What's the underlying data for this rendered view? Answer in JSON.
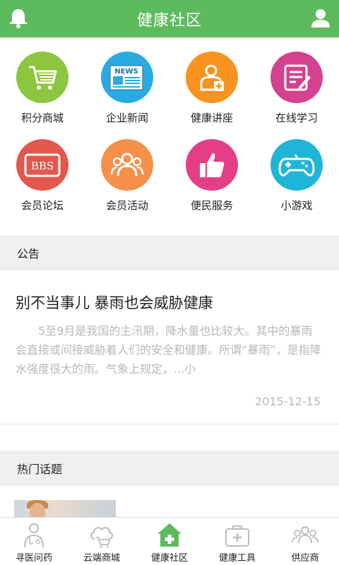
{
  "header": {
    "title": "健康社区",
    "left_icon": "bell-icon",
    "right_icon": "user-icon",
    "color": "#5dbb5d"
  },
  "grid": {
    "items": [
      {
        "label": "积分商城",
        "icon": "shopping-cart-icon",
        "color": "#8cc63f"
      },
      {
        "label": "企业新闻",
        "icon": "newspaper-icon",
        "color": "#29abe2"
      },
      {
        "label": "健康讲座",
        "icon": "doctor-icon",
        "color": "#f7931e"
      },
      {
        "label": "在线学习",
        "icon": "notepad-pen-icon",
        "color": "#d4418e"
      },
      {
        "label": "会员论坛",
        "icon": "bbs-icon",
        "color": "#e2574c"
      },
      {
        "label": "会员活动",
        "icon": "group-icon",
        "color": "#f7904b"
      },
      {
        "label": "便民服务",
        "icon": "thumbs-up-icon",
        "color": "#e43f86"
      },
      {
        "label": "小游戏",
        "icon": "gamepad-icon",
        "color": "#1fb5d6"
      }
    ],
    "logo_text": "BBS",
    "news_text": "NEWS"
  },
  "notice_section": {
    "title": "公告"
  },
  "notice": {
    "title": "别不当事儿 暴雨也会威胁健康",
    "body": "5至9月是我国的主汛期，降水量也比较大。其中的暴雨会直接或间接威胁着人们的安全和健康。所谓“暴雨”，是指降水强度很大的雨。气象上规定，...小",
    "date": "2015-12-15"
  },
  "topics_section": {
    "title": "热门话题"
  },
  "tabbar": {
    "items": [
      {
        "label": "寻医问药",
        "icon": "doctor-stethoscope-icon",
        "active": false
      },
      {
        "label": "云端商城",
        "icon": "cloud-cart-icon",
        "active": false
      },
      {
        "label": "健康社区",
        "icon": "home-plus-icon",
        "active": true
      },
      {
        "label": "健康工具",
        "icon": "medical-kit-icon",
        "active": false
      },
      {
        "label": "供应商",
        "icon": "people-icon",
        "active": false
      }
    ],
    "active_color": "#5dbb5d",
    "inactive_color": "#bdbdbd"
  }
}
